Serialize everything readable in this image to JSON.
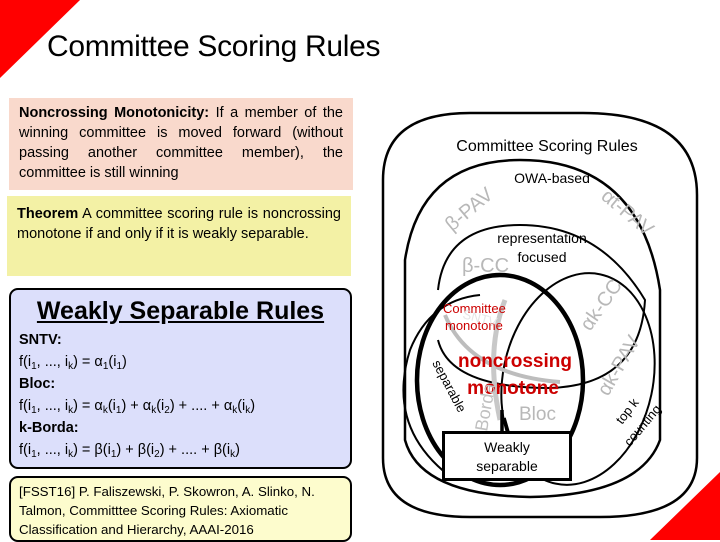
{
  "slide": {
    "title": "Committee Scoring Rules",
    "accent_color": "#ff0000"
  },
  "definition": {
    "term": "Noncrossing Monotonicity:",
    "text": " If a member of the winning committee is moved forward (without passing another committee member), the committee is still winning",
    "background": "#f9d9cc"
  },
  "theorem": {
    "label": "Theorem",
    "text": " A committee scoring rule is noncrossing monotone if and only if it is weakly separable.",
    "background": "#f3f1a5"
  },
  "weakly_separable_rules": {
    "title": "Weakly Separable Rules",
    "background": "#dcdffb",
    "rules": [
      {
        "name": "SNTV:",
        "formula_html": "f(i<sub>1</sub>, ..., i<sub>k</sub>) = α<sub>1</sub>(i<sub>1</sub>)"
      },
      {
        "name": "Bloc:",
        "formula_html": "f(i<sub>1</sub>, ..., i<sub>k</sub>) = α<sub>k</sub>(i<sub>1</sub>) + α<sub>k</sub>(i<sub>2</sub>) + .... + α<sub>k</sub>(i<sub>k</sub>)"
      },
      {
        "name": "k-Borda:",
        "formula_html": "f(i<sub>1</sub>, ..., i<sub>k</sub>) = β(i<sub>1</sub>) + β(i<sub>2</sub>) + .... + β(i<sub>k</sub>)"
      }
    ]
  },
  "citation": {
    "text": "[FSST16] P. Faliszewski, P. Skowron, A. Slinko, N. Talmon, Committtee Scoring Rules: Axiomatic Classification and Hierarchy, AAAI-2016",
    "background": "#fdfccd"
  },
  "diagram": {
    "outer_label": "Committee Scoring Rules",
    "owa_label": "OWA-based",
    "representation_label_1": "representation",
    "representation_label_2": "focused",
    "committee_monotone_1": "Committee",
    "committee_monotone_2": "monotone",
    "noncrossing_1": "noncrossing",
    "noncrossing_2": "monotone",
    "separable_label": "separable",
    "top_k_1": "top k",
    "top_k_2": "counting",
    "weakly_1": "Weakly",
    "weakly_2": "separable",
    "rules_grey": {
      "beta_pav": "β-PAV",
      "alpha_t_pav": "αt-PAV",
      "beta_cc": "β-CC",
      "alpha_k_cc": "αk-CC",
      "alpha_k_pav": "αk-PAV",
      "sntv": "SNTV",
      "borda": "Borda",
      "bloc": "Bloc"
    },
    "highlight_color": "#cc0000",
    "grey_color": "#b8b8b8"
  }
}
